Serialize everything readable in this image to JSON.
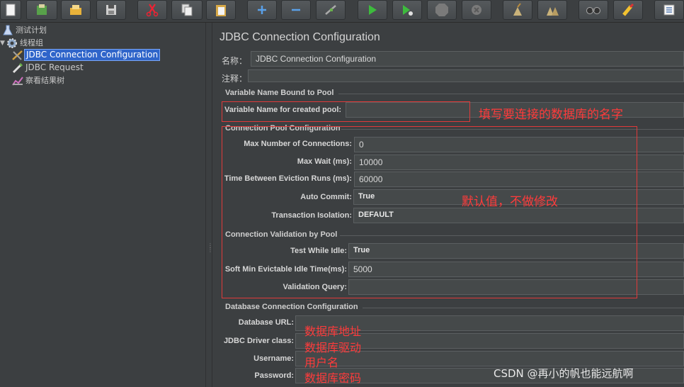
{
  "toolbar": {
    "buttons": [
      {
        "name": "new-icon"
      },
      {
        "name": "templates-icon"
      },
      {
        "name": "open-icon"
      },
      {
        "name": "save-icon"
      },
      {
        "name": "cut-icon"
      },
      {
        "name": "copy-icon"
      },
      {
        "name": "paste-icon"
      },
      {
        "name": "expand-icon"
      },
      {
        "name": "collapse-icon"
      },
      {
        "name": "toggle-icon"
      },
      {
        "name": "start-icon"
      },
      {
        "name": "start-no-pause-icon"
      },
      {
        "name": "stop-icon"
      },
      {
        "name": "shutdown-icon"
      },
      {
        "name": "clear-icon"
      },
      {
        "name": "clear-all-icon"
      },
      {
        "name": "search-icon"
      },
      {
        "name": "reset-search-icon"
      },
      {
        "name": "function-helper-icon"
      }
    ]
  },
  "tree": {
    "items": [
      {
        "label": "测试计划",
        "icon": "test-plan-icon"
      },
      {
        "label": "线程组",
        "icon": "thread-group-icon"
      },
      {
        "label": "JDBC Connection Configuration",
        "icon": "config-element-icon",
        "selected": true
      },
      {
        "label": "JDBC Request",
        "icon": "sampler-icon"
      },
      {
        "label": "察看结果树",
        "icon": "listener-icon"
      }
    ]
  },
  "main": {
    "title": "JDBC Connection Configuration",
    "name_label": "名称：",
    "name_value": "JDBC Connection Configuration",
    "comment_label": "注释：",
    "comment_value": "",
    "sections": {
      "variable": {
        "title": "Variable Name Bound to Pool",
        "pool_var_label": "Variable Name for created pool:",
        "pool_var_value": ""
      },
      "pool": {
        "title": "Connection Pool Configuration",
        "max_conn_label": "Max Number of Connections:",
        "max_conn_value": "0",
        "max_wait_label": "Max Wait (ms):",
        "max_wait_value": "10000",
        "eviction_label": "Time Between Eviction Runs (ms):",
        "eviction_value": "60000",
        "auto_commit_label": "Auto Commit:",
        "auto_commit_value": "True",
        "isolation_label": "Transaction Isolation:",
        "isolation_value": "DEFAULT"
      },
      "validation": {
        "title": "Connection Validation by Pool",
        "test_idle_label": "Test While Idle:",
        "test_idle_value": "True",
        "soft_min_label": "Soft Min Evictable Idle Time(ms):",
        "soft_min_value": "5000",
        "query_label": "Validation Query:",
        "query_value": ""
      },
      "database": {
        "title": "Database Connection Configuration",
        "url_label": "Database URL:",
        "url_value": "",
        "driver_label": "JDBC Driver class:",
        "driver_value": "",
        "username_label": "Username:",
        "username_value": "",
        "password_label": "Password:",
        "password_value": ""
      }
    }
  },
  "annotations": {
    "pool_name_note": "填写要连接的数据库的名字",
    "defaults_note": "默认值，不做修改",
    "url_note": "数据库地址",
    "driver_note": "数据库驱动",
    "username_note": "用户名",
    "password_note": "数据库密码"
  },
  "watermark": "CSDN @再小的帆也能远航啊",
  "colors": {
    "background": "#3c3f41",
    "selection": "#2f65ca",
    "annotation_red": "#ff3b3b"
  }
}
